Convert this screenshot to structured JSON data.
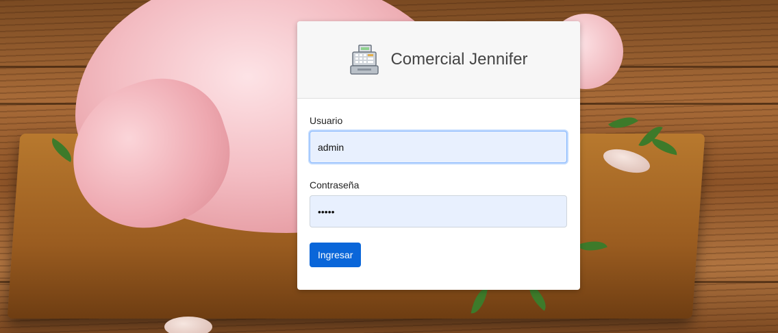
{
  "brand": {
    "name": "Comercial Jennifer",
    "icon": "cash-register-icon"
  },
  "form": {
    "username": {
      "label": "Usuario",
      "value": "admin"
    },
    "password": {
      "label": "Contraseña",
      "value": "•••••"
    },
    "submit_label": "Ingresar"
  },
  "colors": {
    "primary": "#0a66d9",
    "autofill_bg": "#e8f0fe",
    "header_bg": "#f7f7f7"
  }
}
